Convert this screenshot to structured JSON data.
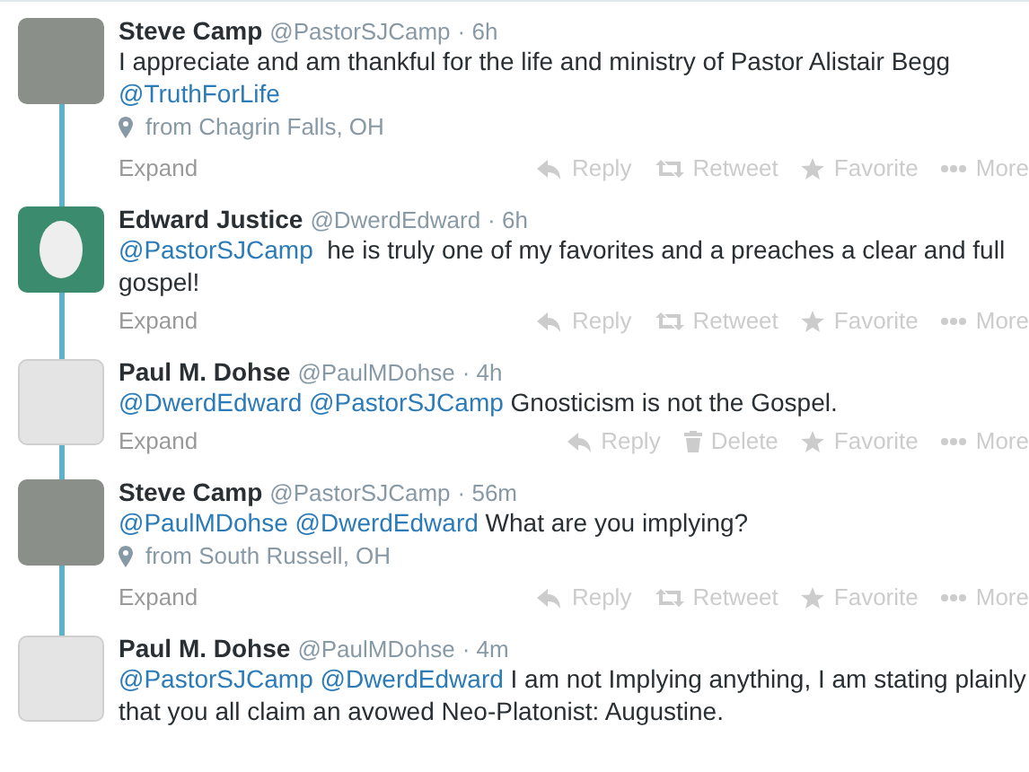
{
  "tweets": [
    {
      "avatar": {
        "kind": "photo"
      },
      "name": "Steve Camp",
      "handle": "@PastorSJCamp",
      "time": "· 6h",
      "thread_below": true,
      "body": [
        {
          "kind": "text",
          "text": "I appreciate and am thankful for the life and ministry of Pastor Alistair Begg "
        },
        {
          "kind": "mention",
          "text": "@TruthForLife"
        }
      ],
      "location": "from Chagrin Falls, OH",
      "expand": "Expand",
      "actions": [
        {
          "kind": "reply",
          "label": "Reply"
        },
        {
          "kind": "retweet",
          "label": "Retweet"
        },
        {
          "kind": "favorite",
          "label": "Favorite"
        },
        {
          "kind": "more",
          "label": "More"
        }
      ]
    },
    {
      "avatar": {
        "kind": "egg"
      },
      "name": "Edward Justice",
      "handle": "@DwerdEdward",
      "time": "· 6h",
      "thread_below": true,
      "body": [
        {
          "kind": "mention",
          "text": "@PastorSJCamp"
        },
        {
          "kind": "text",
          "text": "  he is truly one of my favorites and a preaches a clear and full gospel!"
        }
      ],
      "expand": "Expand",
      "actions": [
        {
          "kind": "reply",
          "label": "Reply"
        },
        {
          "kind": "retweet",
          "label": "Retweet"
        },
        {
          "kind": "favorite",
          "label": "Favorite"
        },
        {
          "kind": "more",
          "label": "More"
        }
      ]
    },
    {
      "avatar": {
        "kind": "sketch"
      },
      "name": "Paul M. Dohse",
      "handle": "@PaulMDohse",
      "time": "· 4h",
      "thread_below": true,
      "body": [
        {
          "kind": "mention",
          "text": "@DwerdEdward"
        },
        {
          "kind": "mention",
          "text": "@PastorSJCamp"
        },
        {
          "kind": "text",
          "text": " Gnosticism is not the Gospel."
        }
      ],
      "expand": "Expand",
      "actions": [
        {
          "kind": "reply",
          "label": "Reply"
        },
        {
          "kind": "delete",
          "label": "Delete"
        },
        {
          "kind": "favorite",
          "label": "Favorite"
        },
        {
          "kind": "more",
          "label": "More"
        }
      ]
    },
    {
      "avatar": {
        "kind": "photo"
      },
      "name": "Steve Camp",
      "handle": "@PastorSJCamp",
      "time": "· 56m",
      "thread_below": true,
      "body": [
        {
          "kind": "mention",
          "text": "@PaulMDohse"
        },
        {
          "kind": "mention",
          "text": "@DwerdEdward"
        },
        {
          "kind": "text",
          "text": " What are you implying?"
        }
      ],
      "location": "from South Russell, OH",
      "expand": "Expand",
      "actions": [
        {
          "kind": "reply",
          "label": "Reply"
        },
        {
          "kind": "retweet",
          "label": "Retweet"
        },
        {
          "kind": "favorite",
          "label": "Favorite"
        },
        {
          "kind": "more",
          "label": "More"
        }
      ]
    },
    {
      "avatar": {
        "kind": "sketch"
      },
      "name": "Paul M. Dohse",
      "handle": "@PaulMDohse",
      "time": "· 4m",
      "body": [
        {
          "kind": "mention",
          "text": "@PastorSJCamp"
        },
        {
          "kind": "mention",
          "text": "@DwerdEdward"
        },
        {
          "kind": "text",
          "text": " I am not Implying anything, I am stating plainly that you all claim an avowed Neo-Platonist: Augustine."
        }
      ]
    }
  ]
}
